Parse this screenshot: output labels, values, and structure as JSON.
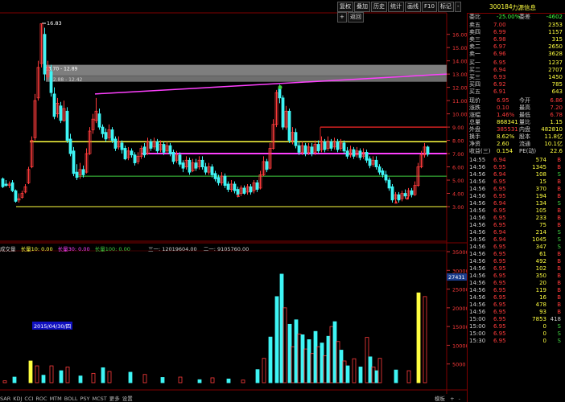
{
  "toolbar": {
    "buttons": [
      "复权",
      "叠加",
      "历史",
      "统计",
      "画线",
      "F10",
      "标记",
      "-",
      "+",
      "返回"
    ]
  },
  "header": {
    "code": "300184",
    "name": "力源信息"
  },
  "price_chart": {
    "price_labels": [
      "16.00",
      "15.00",
      "14.00",
      "13.00",
      "12.00",
      "11.00",
      "10.00",
      "9.00",
      "8.00",
      "7.00",
      "6.00",
      "5.00",
      "4.00",
      "3.00"
    ],
    "annotations": {
      "high": "16.83",
      "box1": "13.70 - 12.89",
      "box2": "12.88 - 12.42"
    }
  },
  "volume_chart": {
    "legend": [
      "成交量",
      "长量10: 0.00",
      "长量30: 0.00",
      "长量100: 0.00"
    ],
    "indicator_left": "三一: 12019604.00",
    "indicator_right": "二一: 9105760.00",
    "vol_labels": [
      "35000",
      "30000",
      "25000",
      "20000",
      "15000",
      "10000",
      "5000"
    ],
    "current_vol": "27431"
  },
  "date_label": "2015/04/30/四",
  "bottom_tabs": [
    "SAR",
    "KDJ",
    "CCI",
    "ROC",
    "MTM",
    "BOLL",
    "PSY",
    "MCST",
    "更多",
    "设置"
  ],
  "bottom_right": [
    "模板",
    "+",
    "-"
  ],
  "quote": {
    "weibi_label": "委比",
    "weibi": "-25.00%",
    "weicha_label": "委差",
    "weicha": "-4602",
    "sell": [
      {
        "label": "卖五",
        "price": "7.00",
        "vol": "2353"
      },
      {
        "label": "卖四",
        "price": "6.99",
        "vol": "1157"
      },
      {
        "label": "卖三",
        "price": "6.98",
        "vol": "315"
      },
      {
        "label": "卖二",
        "price": "6.97",
        "vol": "2650"
      },
      {
        "label": "卖一",
        "price": "6.96",
        "vol": "3628"
      }
    ],
    "buy": [
      {
        "label": "买一",
        "price": "6.95",
        "vol": "1237"
      },
      {
        "label": "买二",
        "price": "6.94",
        "vol": "2707"
      },
      {
        "label": "买三",
        "price": "6.93",
        "vol": "1450"
      },
      {
        "label": "买四",
        "price": "6.92",
        "vol": "785"
      },
      {
        "label": "买五",
        "price": "6.91",
        "vol": "643"
      }
    ],
    "stats": [
      {
        "l1": "现价",
        "v1": "6.95",
        "l2": "今开",
        "v2": "6.86"
      },
      {
        "l1": "涨跌",
        "v1": "0.10",
        "l2": "最高",
        "v2": "7.20"
      },
      {
        "l1": "涨幅",
        "v1": "1.46%",
        "l2": "最低",
        "v2": "6.78"
      },
      {
        "l1": "总量",
        "v1": "868341",
        "l2": "量比",
        "v2": "1.15"
      },
      {
        "l1": "外盘",
        "v1": "385531",
        "l2": "内盘",
        "v2": "482810"
      },
      {
        "l1": "换手",
        "v1": "8.62%",
        "l2": "股本",
        "v2": "11.8亿"
      },
      {
        "l1": "净资",
        "v1": "2.60",
        "l2": "流通",
        "v2": "10.1亿"
      },
      {
        "l1": "收益(三)",
        "v1": "0.154",
        "l2": "PE(动)",
        "v2": "22.6"
      }
    ],
    "ticks": [
      {
        "t": "14:55",
        "p": "6.94",
        "v": "574",
        "d": "B"
      },
      {
        "t": "14:56",
        "p": "6.95",
        "v": "1345",
        "d": "B"
      },
      {
        "t": "14:56",
        "p": "6.94",
        "v": "108",
        "d": "S"
      },
      {
        "t": "14:56",
        "p": "6.95",
        "v": "15",
        "d": "B"
      },
      {
        "t": "14:56",
        "p": "6.95",
        "v": "370",
        "d": "B"
      },
      {
        "t": "14:56",
        "p": "6.95",
        "v": "194",
        "d": "B"
      },
      {
        "t": "14:56",
        "p": "6.94",
        "v": "134",
        "d": "S"
      },
      {
        "t": "14:56",
        "p": "6.95",
        "v": "105",
        "d": "B"
      },
      {
        "t": "14:56",
        "p": "6.95",
        "v": "233",
        "d": "B"
      },
      {
        "t": "14:56",
        "p": "6.95",
        "v": "75",
        "d": "B"
      },
      {
        "t": "14:56",
        "p": "6.94",
        "v": "214",
        "d": "S"
      },
      {
        "t": "14:56",
        "p": "6.94",
        "v": "1045",
        "d": "S"
      },
      {
        "t": "14:56",
        "p": "6.95",
        "v": "347",
        "d": "S"
      },
      {
        "t": "14:56",
        "p": "6.95",
        "v": "61",
        "d": "B"
      },
      {
        "t": "14:56",
        "p": "6.95",
        "v": "492",
        "d": "B"
      },
      {
        "t": "14:56",
        "p": "6.95",
        "v": "102",
        "d": "B"
      },
      {
        "t": "14:56",
        "p": "6.95",
        "v": "350",
        "d": "B"
      },
      {
        "t": "14:56",
        "p": "6.95",
        "v": "20",
        "d": "B"
      },
      {
        "t": "14:56",
        "p": "6.95",
        "v": "119",
        "d": "B"
      },
      {
        "t": "14:56",
        "p": "6.95",
        "v": "16",
        "d": "B"
      },
      {
        "t": "14:56",
        "p": "6.95",
        "v": "478",
        "d": "B"
      },
      {
        "t": "14:56",
        "p": "6.95",
        "v": "93",
        "d": "B"
      },
      {
        "t": "15:00",
        "p": "6.95",
        "v": "7853",
        "d": "418"
      },
      {
        "t": "15:00",
        "p": "6.95",
        "v": "0",
        "d": "S"
      },
      {
        "t": "15:00",
        "p": "6.95",
        "v": "0",
        "d": "S"
      },
      {
        "t": "15:30",
        "p": "6.95",
        "v": "0",
        "d": "S"
      }
    ]
  },
  "colors": {
    "up": "#ff3b3b",
    "down": "#3ef5f5",
    "yellow": "#ffff40",
    "magenta": "#ff40ff",
    "green": "#40d040"
  }
}
